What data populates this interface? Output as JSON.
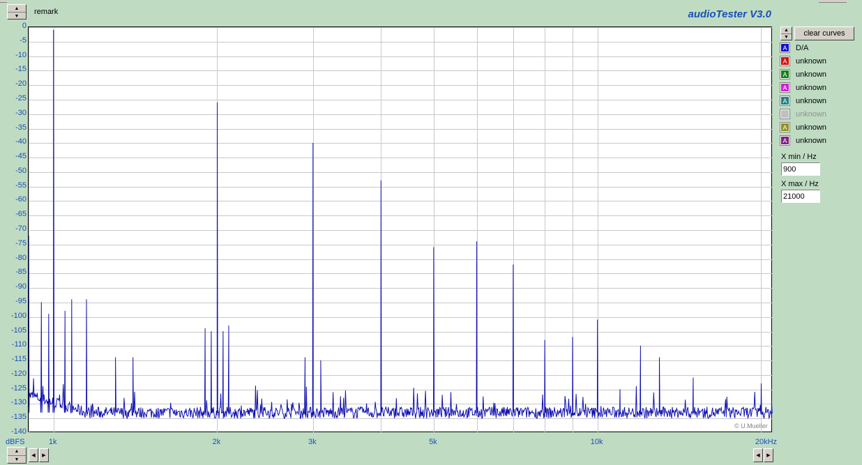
{
  "header": {
    "remark": "remark",
    "app_title": "audioTester  V3.0"
  },
  "panel": {
    "clear_label": "clear curves",
    "curves": [
      {
        "label": "D/A",
        "color": "#1010d0",
        "enabled": true
      },
      {
        "label": "unknown",
        "color": "#d01010",
        "enabled": true
      },
      {
        "label": "unknown",
        "color": "#108010",
        "enabled": true
      },
      {
        "label": "unknown",
        "color": "#d020d0",
        "enabled": true
      },
      {
        "label": "unknown",
        "color": "#208080",
        "enabled": true
      },
      {
        "label": "unknown",
        "color": "#c0c0c0",
        "enabled": false
      },
      {
        "label": "unknown",
        "color": "#909020",
        "enabled": true
      },
      {
        "label": "unknown",
        "color": "#802080",
        "enabled": true
      }
    ],
    "xmin_label": "X min / Hz",
    "xmin_value": "900",
    "xmax_label": "X max / Hz",
    "xmax_value": "21000"
  },
  "plot": {
    "y_unit_label": "dBFS",
    "copyright": "© U.Mueller",
    "line_color": "#1010b0"
  },
  "chart_data": {
    "type": "line",
    "x_scale": "log",
    "xlim": [
      900,
      21000
    ],
    "ylim": [
      -140,
      0
    ],
    "ylabel": "dBFS",
    "grid": true,
    "y_ticks": [
      0,
      -5,
      -10,
      -15,
      -20,
      -25,
      -30,
      -35,
      -40,
      -45,
      -50,
      -55,
      -60,
      -65,
      -70,
      -75,
      -80,
      -85,
      -90,
      -95,
      -100,
      -105,
      -110,
      -115,
      -120,
      -125,
      -130,
      -135,
      -140
    ],
    "x_tick_labels": [
      {
        "value": 1000,
        "label": "1k"
      },
      {
        "value": 2000,
        "label": "2k"
      },
      {
        "value": 3000,
        "label": "3k"
      },
      {
        "value": 5000,
        "label": "5k"
      },
      {
        "value": 10000,
        "label": "10k"
      },
      {
        "value": 20000,
        "label": "20kHz"
      }
    ],
    "noise_floor_dB": -133,
    "series": [
      {
        "name": "D/A",
        "color": "#1010b0",
        "peaks": [
          {
            "x": 1000,
            "y": -1
          },
          {
            "x": 2000,
            "y": -26
          },
          {
            "x": 3000,
            "y": -40
          },
          {
            "x": 4000,
            "y": -53
          },
          {
            "x": 5000,
            "y": -76
          },
          {
            "x": 6000,
            "y": -74
          },
          {
            "x": 7000,
            "y": -82
          },
          {
            "x": 8000,
            "y": -108
          },
          {
            "x": 9000,
            "y": -107
          },
          {
            "x": 10000,
            "y": -101
          },
          {
            "x": 11000,
            "y": -125
          },
          {
            "x": 12000,
            "y": -110
          },
          {
            "x": 13000,
            "y": -114
          },
          {
            "x": 15000,
            "y": -121
          },
          {
            "x": 20000,
            "y": -123
          },
          {
            "x": 900,
            "y": -72
          },
          {
            "x": 950,
            "y": -95
          },
          {
            "x": 980,
            "y": -99
          },
          {
            "x": 1050,
            "y": -98
          },
          {
            "x": 1080,
            "y": -94
          },
          {
            "x": 1150,
            "y": -94
          },
          {
            "x": 1300,
            "y": -114
          },
          {
            "x": 1400,
            "y": -114
          },
          {
            "x": 1900,
            "y": -104
          },
          {
            "x": 1950,
            "y": -105
          },
          {
            "x": 2050,
            "y": -105
          },
          {
            "x": 2100,
            "y": -103
          },
          {
            "x": 2900,
            "y": -114
          },
          {
            "x": 3100,
            "y": -115
          },
          {
            "x": 20900,
            "y": -129
          }
        ]
      }
    ]
  }
}
